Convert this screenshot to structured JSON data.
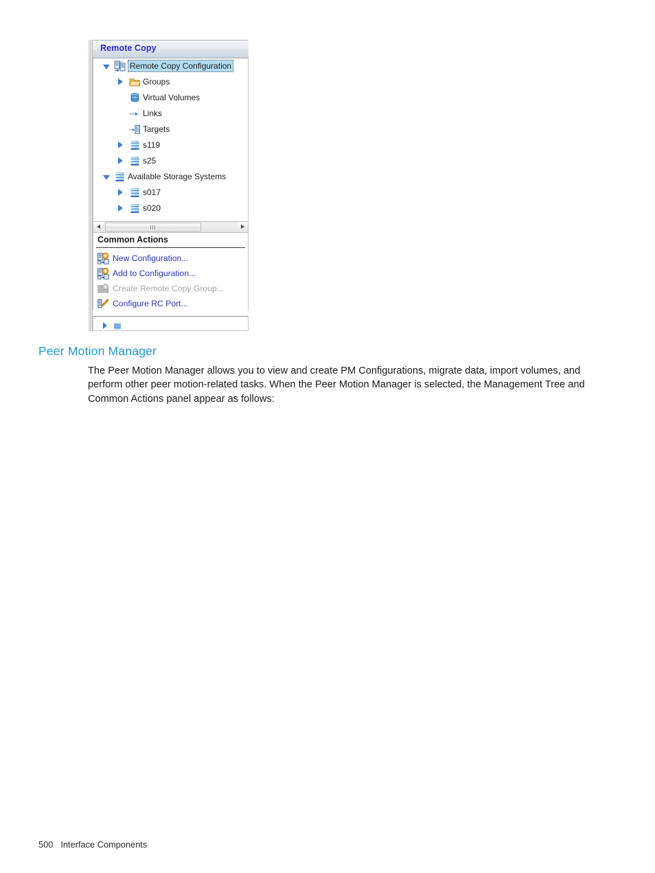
{
  "page": {
    "footer_page_number": "500",
    "footer_section": "Interface Components"
  },
  "document": {
    "heading": "Peer Motion Manager",
    "paragraph": "The Peer Motion Manager allows you to view and create PM Configurations, migrate data, import volumes, and perform other peer motion-related tasks. When the Peer Motion Manager is selected, the Management Tree and Common Actions panel appear as follows:"
  },
  "screenshot": {
    "panel_title": "Remote Copy",
    "tree": {
      "items": [
        {
          "label": "Remote Copy Configuration",
          "indent": 34,
          "twisty_indent": 14,
          "twisty": "expanded",
          "icon": "remote-copy-configuration-icon",
          "icon_indent": 30,
          "label_indent": 50,
          "selected": true
        },
        {
          "label": "Groups",
          "indent": 54,
          "twisty_indent": 36,
          "twisty": "collapsed",
          "icon": "folder-icon",
          "icon_indent": 52,
          "label_indent": 72,
          "selected": false
        },
        {
          "label": "Virtual Volumes",
          "indent": 54,
          "twisty_indent": null,
          "twisty": "none",
          "icon": "virtual-volumes-icon",
          "icon_indent": 52,
          "label_indent": 72,
          "selected": false
        },
        {
          "label": "Links",
          "indent": 54,
          "twisty_indent": null,
          "twisty": "none",
          "icon": "links-arrow-icon",
          "icon_indent": 52,
          "label_indent": 72,
          "selected": false
        },
        {
          "label": "Targets",
          "indent": 54,
          "twisty_indent": null,
          "twisty": "none",
          "icon": "targets-icon",
          "icon_indent": 52,
          "label_indent": 72,
          "selected": false
        },
        {
          "label": "s119",
          "indent": 54,
          "twisty_indent": 36,
          "twisty": "collapsed",
          "icon": "storage-system-icon",
          "icon_indent": 52,
          "label_indent": 72,
          "selected": false
        },
        {
          "label": "s25",
          "indent": 54,
          "twisty_indent": 36,
          "twisty": "collapsed",
          "icon": "storage-system-icon",
          "icon_indent": 52,
          "label_indent": 72,
          "selected": false
        },
        {
          "label": "Available Storage Systems",
          "indent": 34,
          "twisty_indent": 14,
          "twisty": "expanded",
          "icon": "storage-system-icon",
          "icon_indent": 30,
          "label_indent": 50,
          "selected": false
        },
        {
          "label": "s017",
          "indent": 54,
          "twisty_indent": 36,
          "twisty": "collapsed",
          "icon": "storage-system-icon",
          "icon_indent": 52,
          "label_indent": 72,
          "selected": false
        },
        {
          "label": "s020",
          "indent": 54,
          "twisty_indent": 36,
          "twisty": "collapsed",
          "icon": "storage-system-icon",
          "icon_indent": 52,
          "label_indent": 72,
          "selected": false
        }
      ]
    },
    "common_actions": {
      "header": "Common Actions",
      "items": [
        {
          "label": "New Configuration...",
          "icon": "new-configuration-icon",
          "disabled": false
        },
        {
          "label": "Add to Configuration...",
          "icon": "add-to-configuration-icon",
          "disabled": false
        },
        {
          "label": "Create Remote Copy Group...",
          "icon": "create-remote-copy-group-icon",
          "disabled": true
        },
        {
          "label": "Configure RC Port...",
          "icon": "configure-rc-port-icon",
          "disabled": false
        }
      ]
    },
    "colors": {
      "panel_title_text": "#2a2ad8",
      "selection_highlight": "#b3dcf2",
      "action_link": "#2a32cf",
      "action_link_disabled": "#a6a6a6",
      "heading_accent": "#1b9ad6",
      "twisty_blue": "#3f7fd0"
    }
  }
}
